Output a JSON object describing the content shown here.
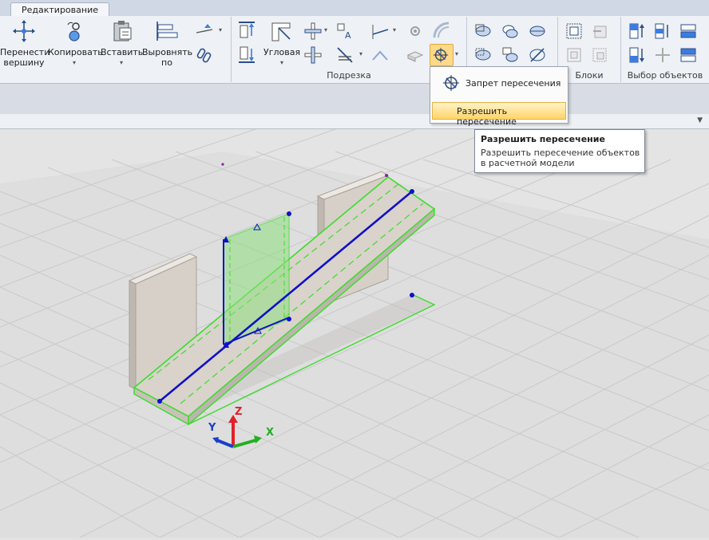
{
  "tabs": {
    "active": "Редактирование"
  },
  "ribbon": {
    "edit": {
      "move_vertex": "Перенести вершину",
      "copy": "Копировать",
      "paste": "Вставить",
      "align": "Выровнять по"
    },
    "podrezka": {
      "corner": "Угловая",
      "label": "Подрезка"
    },
    "blocks": {
      "label": "Блоки"
    },
    "selection": {
      "label": "Выбор объектов"
    }
  },
  "menu": {
    "forbid": "Запрет пересечения",
    "allow": "Разрешить пересечение"
  },
  "tooltip": {
    "title": "Разрешить пересечение",
    "desc": "Разрешить пересечение объектов в расчетной модели"
  },
  "axes": {
    "x": "X",
    "y": "Y",
    "z": "Z"
  },
  "colors": {
    "selection": "#3ddc2c",
    "axis_line": "#1010c8",
    "wall": "#d6d0c8"
  }
}
